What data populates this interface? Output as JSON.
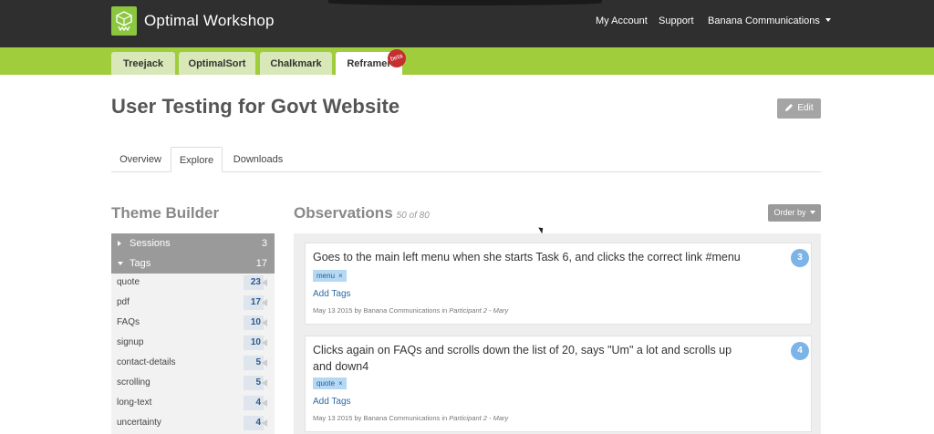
{
  "app": {
    "name": "Optimal Workshop",
    "nav": [
      "My Account",
      "Support"
    ],
    "account_menu": "Banana Communications"
  },
  "apps": {
    "tabs": [
      "Treejack",
      "OptimalSort",
      "Chalkmark",
      "Reframer"
    ],
    "active": "Reframer",
    "beta_label": "beta"
  },
  "page": {
    "title": "User Testing for Govt Website",
    "edit_label": "Edit",
    "tabs": [
      "Overview",
      "Explore",
      "Downloads"
    ],
    "active_tab": "Explore"
  },
  "theme_builder": {
    "title": "Theme Builder",
    "groups": [
      {
        "label": "Sessions",
        "count": "3",
        "expanded": false
      },
      {
        "label": "Tags",
        "count": "17",
        "expanded": true
      }
    ],
    "tags": [
      {
        "name": "quote",
        "count": "23"
      },
      {
        "name": "pdf",
        "count": "17"
      },
      {
        "name": "FAQs",
        "count": "10"
      },
      {
        "name": "signup",
        "count": "10"
      },
      {
        "name": "contact-details",
        "count": "5"
      },
      {
        "name": "scrolling",
        "count": "5"
      },
      {
        "name": "long-text",
        "count": "4"
      },
      {
        "name": "uncertainty",
        "count": "4"
      }
    ]
  },
  "observations": {
    "title": "Observations",
    "count_text": "50 of 80",
    "order_label": "Order by",
    "items": [
      {
        "text": "Goes to the main left menu when she starts Task 6, and clicks the correct link #menu",
        "number": "3",
        "tag": "menu",
        "add_tags": "Add Tags",
        "meta_prefix": "May 13 2015 by Banana Communications in",
        "participant": "Participant 2 - Mary"
      },
      {
        "text": "Clicks again on FAQs and scrolls down the list of 20, says \"Um\" a lot and scrolls up and down4",
        "number": "4",
        "tag": "quote",
        "add_tags": "Add Tags",
        "meta_prefix": "May 13 2015 by Banana Communications in",
        "participant": "Participant 2 - Mary"
      }
    ]
  },
  "colors": {
    "topbar": "#2f2f2f",
    "green": "#9fcd3c",
    "badge": "#7cb4e8",
    "link": "#2c6ba8"
  }
}
